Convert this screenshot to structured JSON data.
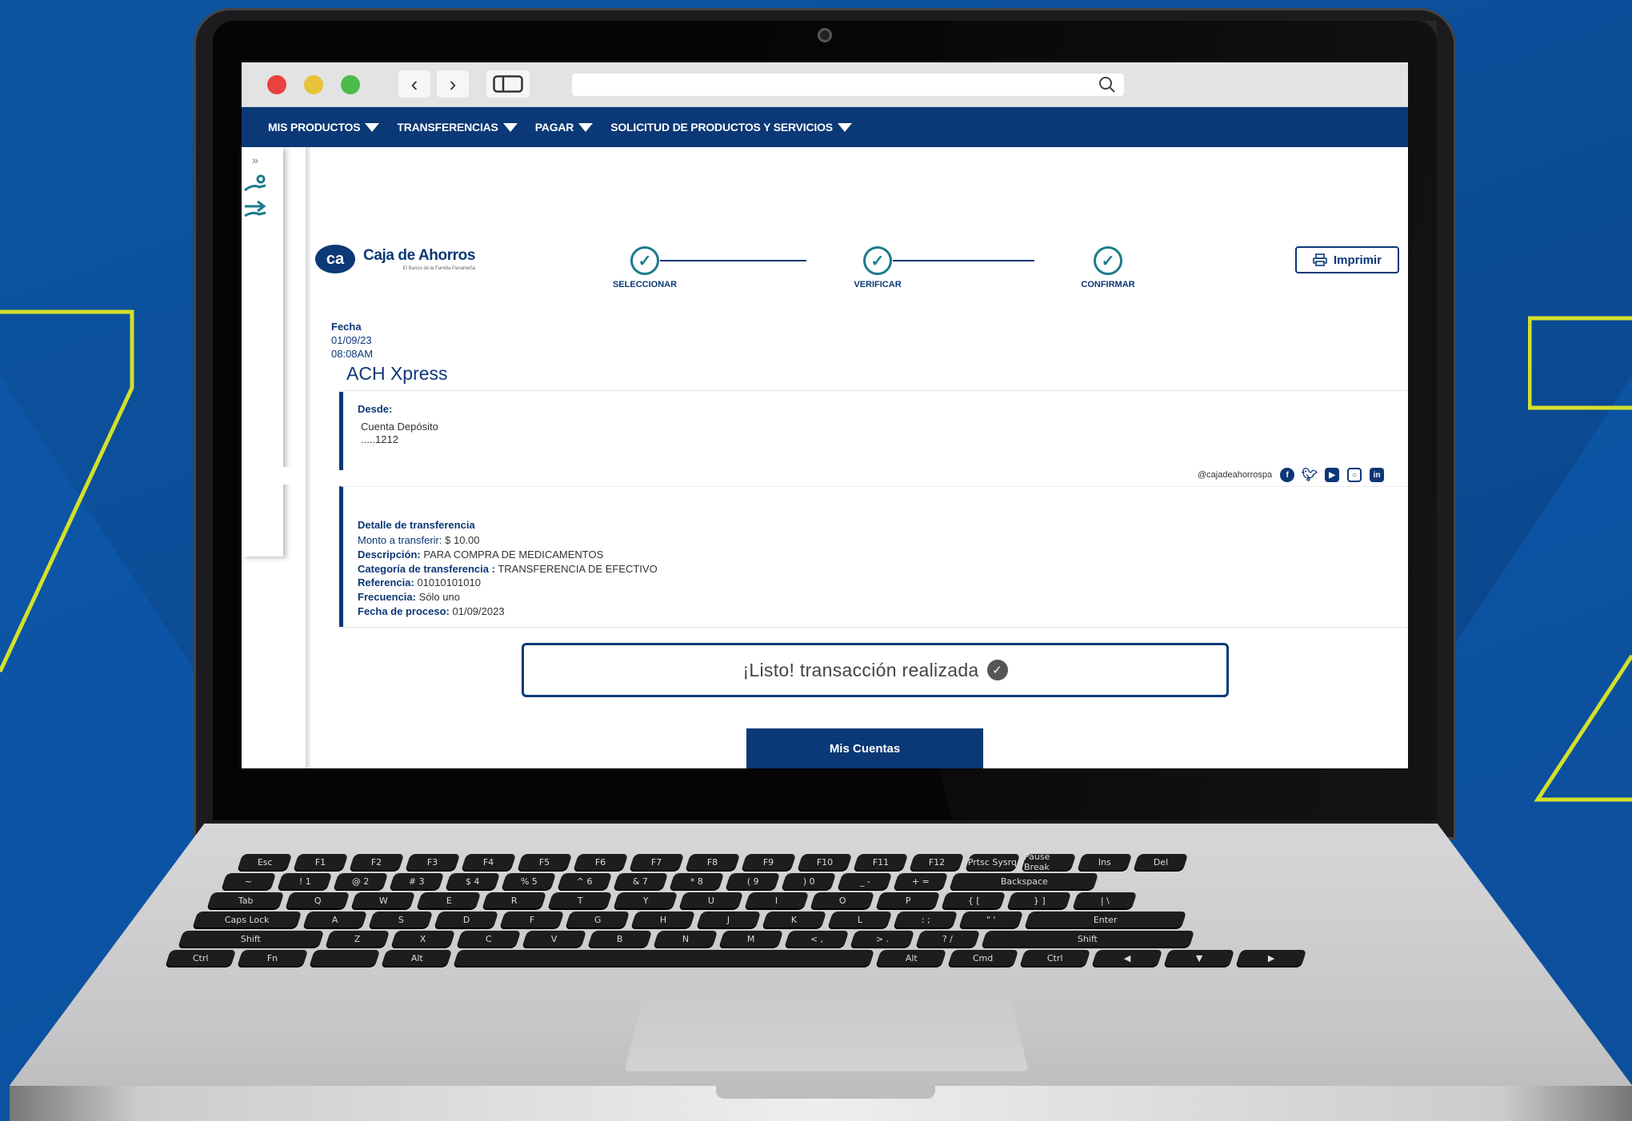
{
  "nav": {
    "items": [
      "MIS PRODUCTOS",
      "TRANSFERENCIAS",
      "PAGAR",
      "SOLICITUD DE PRODUCTOS Y SERVICIOS"
    ]
  },
  "brand": {
    "mark": "ca",
    "name": "Caja de Ahorros",
    "tagline": "El Banco de la Familia Panameña"
  },
  "stepper": {
    "steps": [
      {
        "label": "SELECCIONAR",
        "state": "done"
      },
      {
        "label": "VERIFICAR",
        "state": "done"
      },
      {
        "label": "CONFIRMAR",
        "state": "done"
      }
    ]
  },
  "print_label": "Imprimir",
  "meta": {
    "fecha_label": "Fecha",
    "date": "01/09/23",
    "time": "08:08AM"
  },
  "page_title": "ACH Xpress",
  "from": {
    "label": "Desde:",
    "account": "Cuenta Depósito",
    "number": ".....1212"
  },
  "social": {
    "handle": "@cajadeahorrospa",
    "icons": [
      "facebook-icon",
      "twitter-icon",
      "youtube-icon",
      "instagram-icon",
      "linkedin-icon"
    ]
  },
  "detail": {
    "heading": "Detalle de transferencia",
    "rows": [
      {
        "label": "Monto a transferir:",
        "value": "$  10.00"
      },
      {
        "label": "Descripción:",
        "value": "PARA COMPRA DE MEDICAMENTOS"
      },
      {
        "label": "Categoría de transferencia :",
        "value": "TRANSFERENCIA DE EFECTIVO"
      },
      {
        "label": "Referencia:",
        "value": "01010101010"
      },
      {
        "label": "Frecuencia:",
        "value": "Sólo uno"
      },
      {
        "label": "Fecha de proceso:",
        "value": "01/09/2023"
      }
    ]
  },
  "done_message": "¡Listo! transacción realizada",
  "cta_label": "Mis Cuentas",
  "keyboard": {
    "row1": [
      "Esc",
      "F1",
      "F2",
      "F3",
      "F4",
      "F5",
      "F6",
      "F7",
      "F8",
      "F9",
      "F10",
      "F11",
      "F12",
      "Prtsc Sysrq",
      "Pause Break",
      "Ins",
      "Del"
    ],
    "row2": [
      "~",
      "! 1",
      "@ 2",
      "# 3",
      "$ 4",
      "% 5",
      "^ 6",
      "& 7",
      "* 8",
      "( 9",
      ") 0",
      "_ -",
      "+ =",
      "Backspace"
    ],
    "row3": [
      "Tab",
      "Q",
      "W",
      "E",
      "R",
      "T",
      "Y",
      "U",
      "I",
      "O",
      "P",
      "{ [",
      "} ]",
      "| \\"
    ],
    "row4": [
      "Caps Lock",
      "A",
      "S",
      "D",
      "F",
      "G",
      "H",
      "J",
      "K",
      "L",
      ": ;",
      "\" '",
      "Enter"
    ],
    "row5": [
      "Shift",
      "Z",
      "X",
      "C",
      "V",
      "B",
      "N",
      "M",
      "< ,",
      "> .",
      "? /",
      "Shift"
    ],
    "row6": [
      "Ctrl",
      "Fn",
      "",
      "Alt",
      "",
      "Alt",
      "Cmd",
      "Ctrl",
      "◀",
      "▼",
      "▶"
    ]
  },
  "colors": {
    "navy": "#0b3876",
    "teal": "#1b7a8c",
    "accent_yellow": "#d4e02a",
    "background_blue": "#0b4f9a"
  }
}
